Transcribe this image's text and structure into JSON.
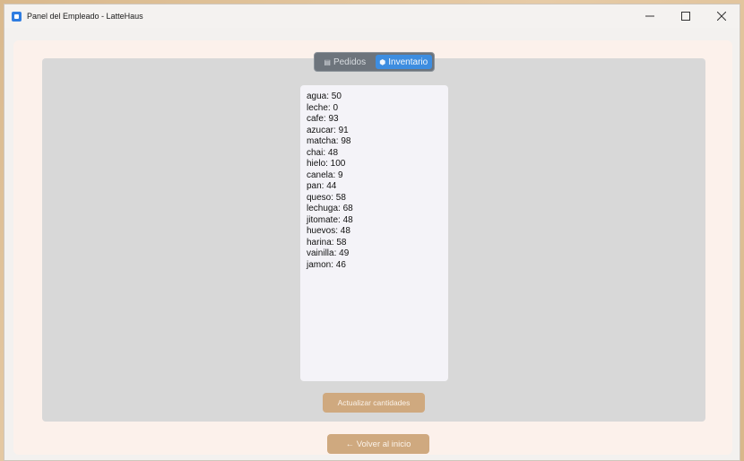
{
  "window": {
    "title": "Panel del Empleado - LatteHaus",
    "minimize_label": "—",
    "maximize_label": "☐",
    "close_label": "✕"
  },
  "tabs": [
    {
      "label": "Pedidos",
      "icon": "clipboard-icon",
      "active": false
    },
    {
      "label": "Inventario",
      "icon": "box-icon",
      "active": true
    }
  ],
  "inventory": [
    "agua: 50",
    "leche: 0",
    "cafe: 93",
    "azucar: 91",
    "matcha: 98",
    "chai: 48",
    "hielo: 100",
    "canela: 9",
    "pan: 44",
    "queso: 58",
    "lechuga: 68",
    "jitomate: 48",
    "huevos: 48",
    "harina: 58",
    "vainilla: 49",
    "jamon: 46"
  ],
  "buttons": {
    "update": "Actualizar cantidades",
    "back": "← Volver al inicio"
  },
  "colors": {
    "accent": "#3d8de0",
    "button": "#cfa97f",
    "panel": "#d8d8d8",
    "background": "#fcf1eb"
  }
}
